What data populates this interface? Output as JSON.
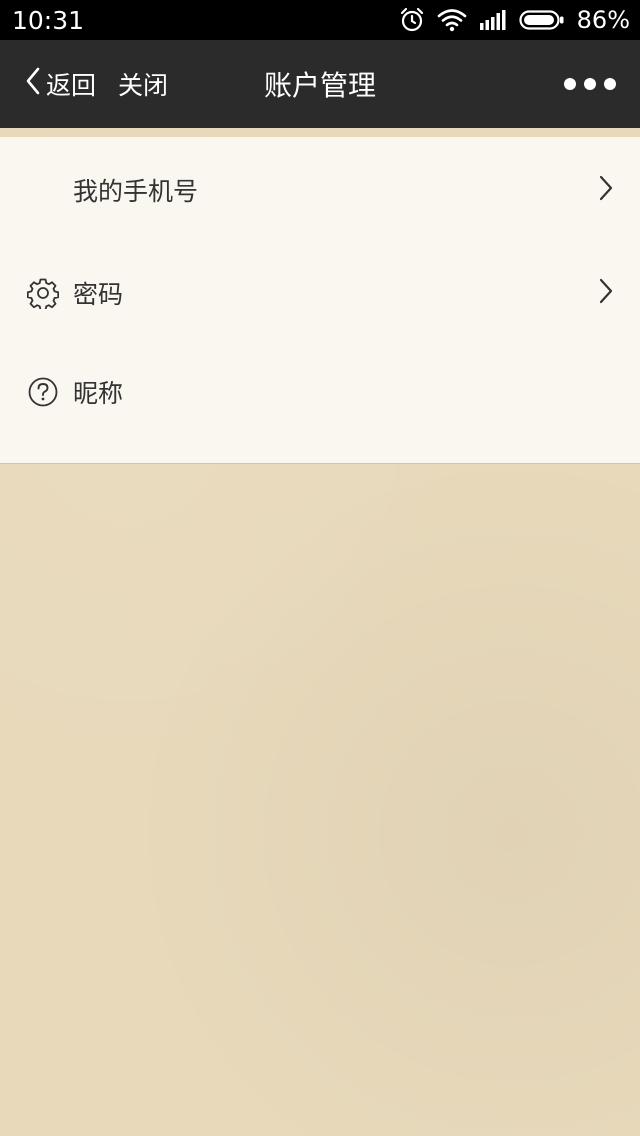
{
  "status_bar": {
    "time": "10:31",
    "battery_percent": "86%",
    "icons": [
      "alarm-icon",
      "wifi-icon",
      "signal-icon",
      "battery-icon"
    ]
  },
  "nav": {
    "back_label": "返回",
    "close_label": "关闭",
    "title": "账户管理",
    "more_icon": "more-dots-icon"
  },
  "menu": {
    "items": [
      {
        "label": "我的手机号",
        "icon": "none",
        "has_chevron": true
      },
      {
        "label": "密码",
        "icon": "gear-icon",
        "has_chevron": true
      },
      {
        "label": "昵称",
        "icon": "help-circle-icon",
        "has_chevron": false
      }
    ]
  },
  "colors": {
    "status_bar_bg": "#000000",
    "nav_bg": "#2b2b2b",
    "card_bg": "#faf7f1",
    "page_bg": "#e8d9bb",
    "text": "#333333"
  }
}
